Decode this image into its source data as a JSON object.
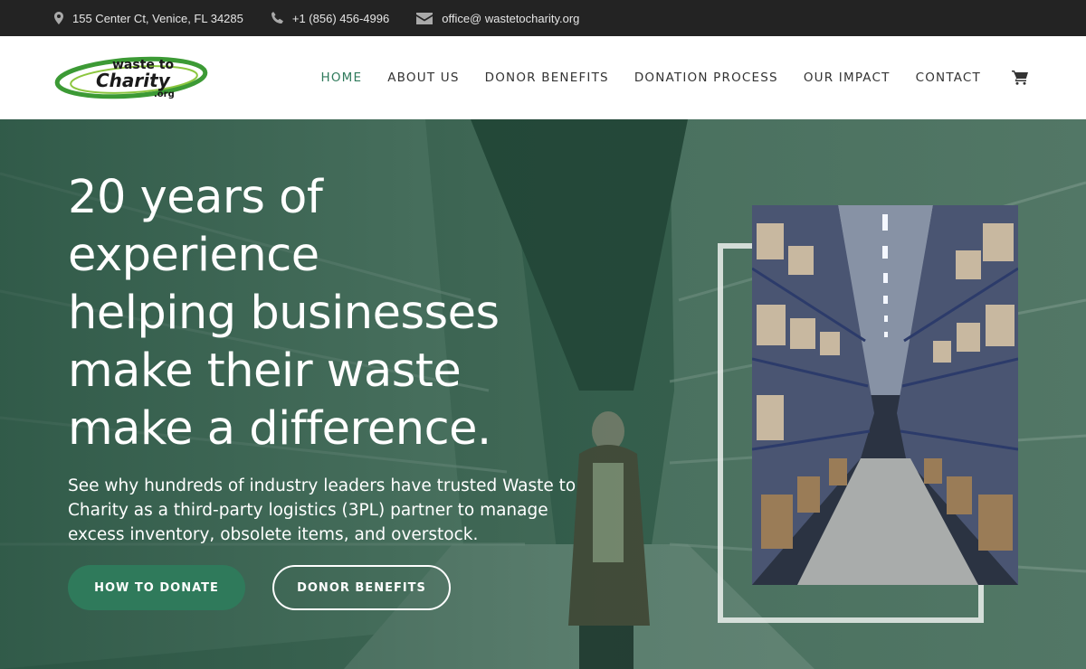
{
  "topbar": {
    "address": "155 Center Ct, Venice, FL 34285",
    "phone": "+1 (856) 456-4996",
    "email": "office@ wastetocharity.org",
    "icons": [
      "map-pin-icon",
      "phone-icon",
      "envelope-icon"
    ]
  },
  "brand": {
    "logo_line1": "waste to",
    "logo_line2": "Charity",
    "logo_line3": ".org",
    "accent_color": "#2f7a5b"
  },
  "nav": {
    "items": [
      {
        "label": "HOME",
        "active": true
      },
      {
        "label": "ABOUT US",
        "active": false
      },
      {
        "label": "DONOR BENEFITS",
        "active": false
      },
      {
        "label": "DONATION PROCESS",
        "active": false
      },
      {
        "label": "OUR IMPACT",
        "active": false
      },
      {
        "label": "CONTACT",
        "active": false
      }
    ],
    "cart_icon": "shopping-cart-icon"
  },
  "hero": {
    "headline_lines": [
      "20 years of",
      "experience",
      "helping businesses",
      "make their waste",
      "make a difference."
    ],
    "subtext": "See why hundreds of industry leaders have trusted Waste to Charity as a third-party logistics (3PL) partner to manage excess inventory, obsolete items, and overstock.",
    "primary_button": "HOW TO DONATE",
    "secondary_button": "DONOR BENEFITS"
  }
}
